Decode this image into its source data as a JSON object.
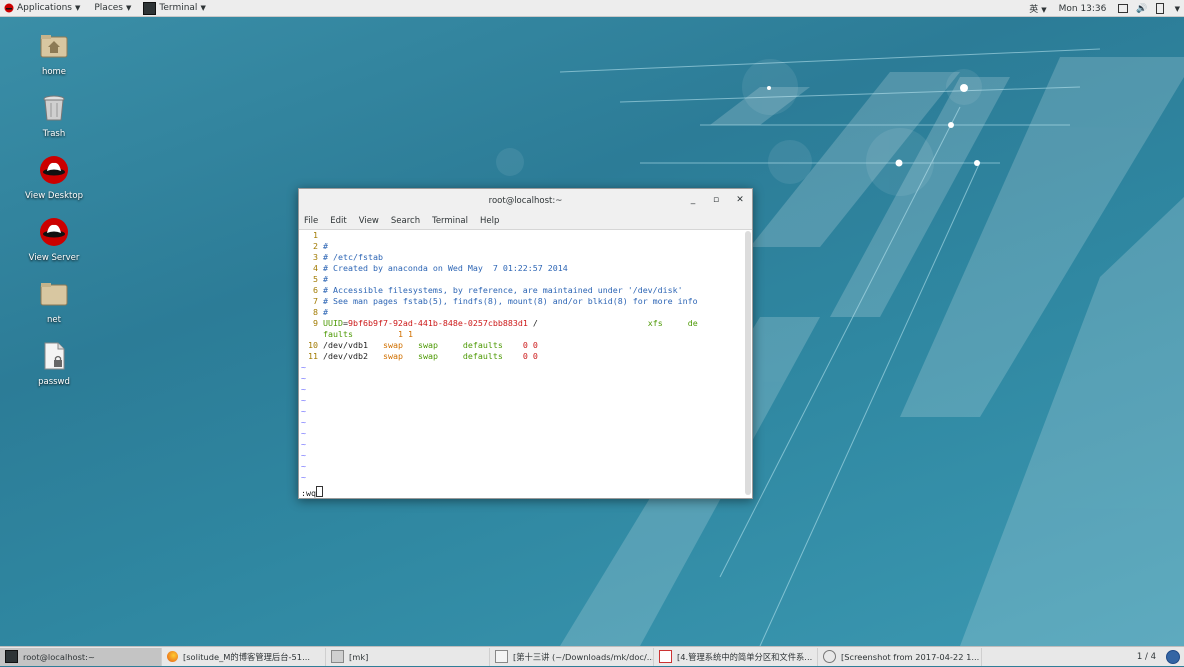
{
  "topbar": {
    "applications": "Applications",
    "places": "Places",
    "terminal": "Terminal",
    "ime": "英",
    "clock": "Mon 13:36"
  },
  "desktop_icons": [
    {
      "label": "home",
      "icon": "folder-home-icon"
    },
    {
      "label": "Trash",
      "icon": "trash-icon"
    },
    {
      "label": "View Desktop",
      "icon": "redhat-icon"
    },
    {
      "label": "View Server",
      "icon": "redhat-icon"
    },
    {
      "label": "net",
      "icon": "folder-icon"
    },
    {
      "label": "passwd",
      "icon": "locked-file-icon"
    }
  ],
  "terminal": {
    "title": "root@localhost:~",
    "menu": [
      "File",
      "Edit",
      "View",
      "Search",
      "Terminal",
      "Help"
    ],
    "lines": {
      "l1n": "1",
      "l2n": "2",
      "l3n": "3",
      "l4n": "4",
      "l5n": "5",
      "l6n": "6",
      "l7n": "7",
      "l8n": "8",
      "l9n": "9",
      "l10n": "10",
      "l11n": "11",
      "l2": "#",
      "l3": "# /etc/fstab",
      "l4": "# Created by anaconda on Wed May  7 01:22:57 2014",
      "l5": "#",
      "l6": "# Accessible filesystems, by reference, are maintained under '/dev/disk'",
      "l7": "# See man pages fstab(5), findfs(8), mount(8) and/or blkid(8) for more info",
      "l8": "#",
      "l9_key": "UUID",
      "l9_eq": "=",
      "l9_uuid": "9bf6b9f7-92ad-441b-848e-0257cbb883d1",
      "l9_mount": "/",
      "l9_fs": "xfs",
      "l9_opt1": "de",
      "l9_opt2": "faults",
      "l9_nums": "1 1",
      "l10_dev": "/dev/vdb1",
      "l10_a": "swap",
      "l10_b": "swap",
      "l10_c": "defaults",
      "l10_d": "0 0",
      "l11_dev": "/dev/vdb2",
      "l11_a": "swap",
      "l11_b": "swap",
      "l11_c": "defaults",
      "l11_d": "0 0",
      "tilde": "~"
    },
    "command": ":wq"
  },
  "taskbar": {
    "tasks": [
      "root@localhost:~",
      "[solitude_M的博客管理后台-51...",
      "[mk]",
      "[第十三讲 (~/Downloads/mk/doc/...",
      "[4.管理系统中的简单分区和文件系...",
      "[Screenshot from 2017-04-22 1..."
    ],
    "pager": "1 / 4"
  },
  "colors": {
    "desktop": "#2f7e98",
    "comment": "#2e66b5",
    "uuid": "#cc1818",
    "swap": "#d07000",
    "defaults": "#4e9a06"
  }
}
